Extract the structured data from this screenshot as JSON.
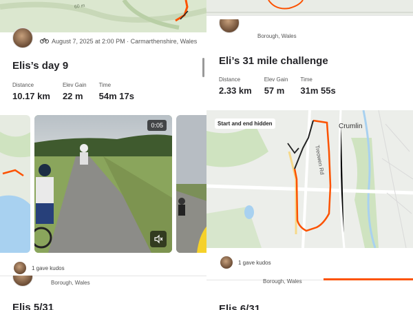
{
  "colors": {
    "accent": "#fc5200",
    "track_black": "#222222",
    "map_green": "#cfe3c0",
    "water": "#a8d1f0"
  },
  "left": {
    "top_map": {
      "contour_label": "60 m"
    },
    "header": {
      "date_location": "August 7, 2025 at 2:00 PM · Carmarthenshire, Wales",
      "icon": "bike-icon"
    },
    "title": "Elis’s day 9",
    "stats": [
      {
        "label": "Distance",
        "value": "10.17 km"
      },
      {
        "label": "Elev Gain",
        "value": "22 m"
      },
      {
        "label": "Time",
        "value": "54m 17s"
      }
    ],
    "video": {
      "duration": "0:05",
      "mute_icon": "muted-speaker-icon"
    },
    "kudos": "1 gave kudos",
    "next": {
      "location": "Borough, Wales",
      "title": "Elis 5/31"
    }
  },
  "right": {
    "header": {
      "location": "Borough, Wales"
    },
    "title": "Eli’s 31 mile challenge",
    "stats": [
      {
        "label": "Distance",
        "value": "2.33 km"
      },
      {
        "label": "Elev Gain",
        "value": "57 m"
      },
      {
        "label": "Time",
        "value": "31m 55s"
      }
    ],
    "map": {
      "badge": "Start and end hidden",
      "town": "Crumlin",
      "road": "Treowen Rd"
    },
    "kudos": "1 gave kudos",
    "next": {
      "location": "Borough, Wales",
      "title": "Elis 6/31"
    }
  }
}
